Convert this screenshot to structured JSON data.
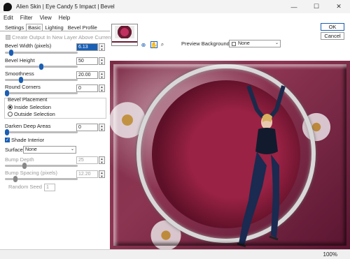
{
  "window": {
    "title": "Alien Skin | Eye Candy 5 Impact | Bevel",
    "controls": {
      "minimize": "—",
      "maximize": "☐",
      "close": "✕"
    }
  },
  "menu": [
    "Edit",
    "Filter",
    "View",
    "Help"
  ],
  "tabs": [
    "Settings",
    "Basic",
    "Lighting",
    "Bevel Profile"
  ],
  "active_tab": "Basic",
  "create_output": {
    "label": "Create Output In New Layer Above Current",
    "checked": true,
    "enabled": false
  },
  "params": {
    "bevel_width": {
      "label": "Bevel Width (pixels)",
      "value": "6.13",
      "level": 0.06
    },
    "bevel_height": {
      "label": "Bevel Height",
      "value": "50",
      "level": 0.5
    },
    "smoothness": {
      "label": "Smoothness",
      "value": "20.00",
      "level": 0.2
    },
    "round_corners": {
      "label": "Round Corners",
      "value": "0",
      "level": 0.0
    },
    "darken_deep": {
      "label": "Darken Deep Areas",
      "value": "0",
      "level": 0.0
    },
    "bump_depth": {
      "label": "Bump Depth",
      "value": "25",
      "level": 0.25,
      "enabled": false
    },
    "bump_spacing": {
      "label": "Bump Spacing (pixels)",
      "value": "12.20",
      "level": 0.12,
      "enabled": false
    }
  },
  "bevel_placement": {
    "label": "Bevel Placement",
    "options": [
      "Inside Selection",
      "Outside Selection"
    ],
    "selected": "Inside Selection"
  },
  "shade_interior": {
    "label": "Shade Interior",
    "checked": true
  },
  "surface": {
    "label": "Surface",
    "value": "None"
  },
  "random_seed": {
    "label": "Random Seed",
    "value": "1"
  },
  "preview_background": {
    "label": "Preview Background",
    "value": "None"
  },
  "buttons": {
    "ok": "OK",
    "cancel": "Cancel"
  },
  "status": {
    "zoom": "100%"
  },
  "colors": {
    "accent": "#1a5fb4",
    "preview_bg": "#7a2a44"
  },
  "icons": [
    "pan-tool-icon",
    "hand-tool-icon",
    "zoom-tool-icon"
  ]
}
